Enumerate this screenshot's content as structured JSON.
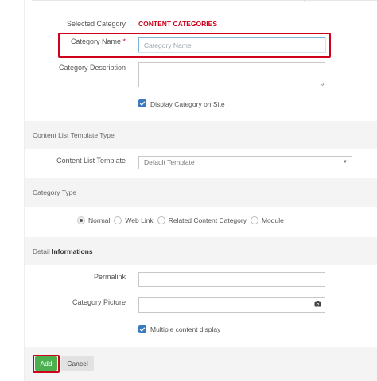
{
  "form": {
    "selected_category_label": "Selected Category",
    "selected_category_value": "CONTENT CATEGORIES",
    "category_name_label": "Category Name",
    "required_mark": "*",
    "category_name_placeholder": "Category Name",
    "category_name_value": "",
    "category_description_label": "Category Description",
    "category_description_value": "",
    "display_on_site_label": "Display Category on Site",
    "display_on_site_checked": true
  },
  "template_section": {
    "title": "Content List Template Type",
    "template_label": "Content List Template",
    "template_selected": "Default Template"
  },
  "category_type_section": {
    "title": "Category Type",
    "options": [
      {
        "label": "Normal",
        "selected": true
      },
      {
        "label": "Web Link",
        "selected": false
      },
      {
        "label": "Related Content Category",
        "selected": false
      },
      {
        "label": "Module",
        "selected": false
      }
    ]
  },
  "detail_section": {
    "title_prefix": "Detail",
    "title_bold": "Informations",
    "permalink_label": "Permalink",
    "permalink_value": "",
    "category_picture_label": "Category Picture",
    "category_picture_value": "",
    "multiple_display_label": "Multiple content display",
    "multiple_display_checked": true
  },
  "actions": {
    "add_label": "Add",
    "cancel_label": "Cancel"
  },
  "colors": {
    "accent_red": "#d0021b",
    "checkbox_blue": "#3a7bbf",
    "add_green": "#4caf50"
  },
  "icons": {
    "picture_button": "camera-icon",
    "select_arrow": "chevron-down-icon",
    "checkmark": "check-icon"
  }
}
